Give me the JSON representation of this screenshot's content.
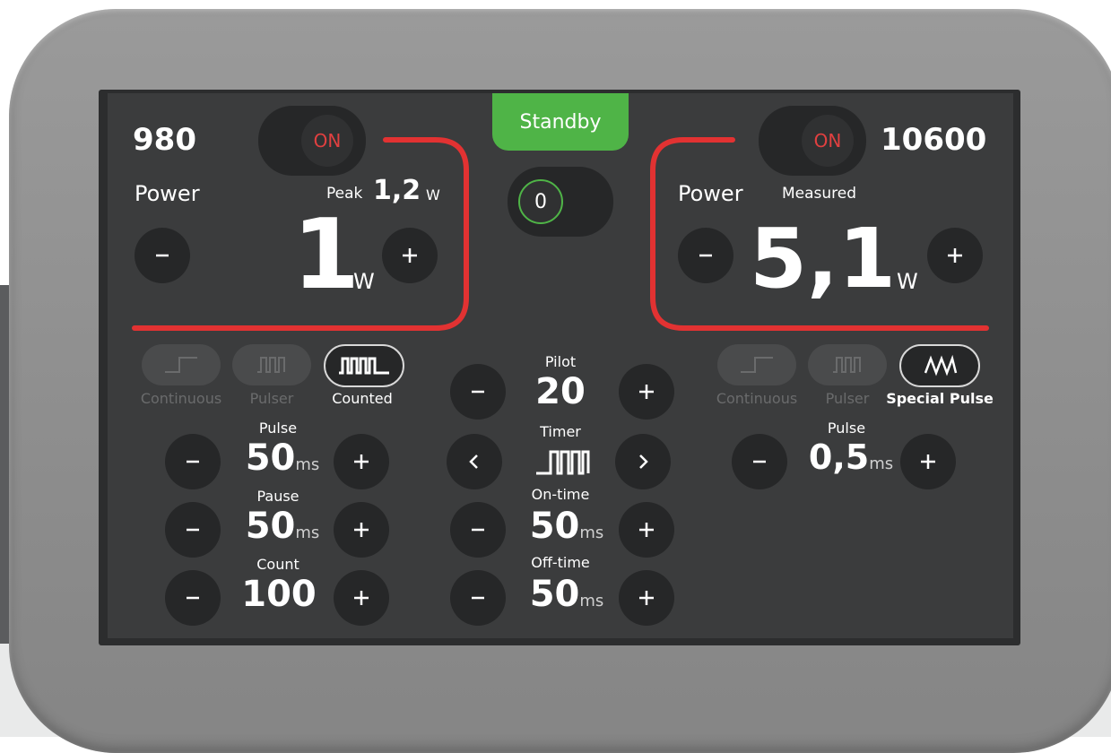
{
  "colors": {
    "accent_red": "#e23232",
    "standby_green": "#4fb447",
    "on_red": "#e04040"
  },
  "status": {
    "label": "Standby",
    "counter": "0"
  },
  "left_laser": {
    "wavelength": "980",
    "toggle_label": "ON",
    "power_label": "Power",
    "peak_label": "Peak",
    "peak_value": "1,2",
    "peak_unit": "W",
    "power_value": "1",
    "power_unit": "W",
    "modes": [
      {
        "label": "Continuous",
        "icon": "continuous-wave-icon",
        "active": false
      },
      {
        "label": "Pulser",
        "icon": "pulser-wave-icon",
        "active": false
      },
      {
        "label": "Counted",
        "icon": "counted-wave-icon",
        "active": true
      }
    ],
    "params": [
      {
        "label": "Pulse",
        "value": "50",
        "unit": "ms"
      },
      {
        "label": "Pause",
        "value": "50",
        "unit": "ms"
      },
      {
        "label": "Count",
        "value": "100",
        "unit": ""
      }
    ]
  },
  "center": {
    "pilot_label": "Pilot",
    "pilot_value": "20",
    "timer_label": "Timer",
    "timer_icon": "pulse-train-icon",
    "on_time_label": "On-time",
    "on_time_value": "50",
    "on_time_unit": "ms",
    "off_time_label": "Off-time",
    "off_time_value": "50",
    "off_time_unit": "ms"
  },
  "right_laser": {
    "wavelength": "10600",
    "toggle_label": "ON",
    "power_label": "Power",
    "measured_label": "Measured",
    "power_value": "5,1",
    "power_unit": "W",
    "modes": [
      {
        "label": "Continuous",
        "icon": "continuous-wave-icon",
        "active": false
      },
      {
        "label": "Pulser",
        "icon": "pulser-wave-icon",
        "active": false
      },
      {
        "label": "Special Pulse",
        "icon": "special-pulse-icon",
        "active": true
      }
    ],
    "params": [
      {
        "label": "Pulse",
        "value": "0,5",
        "unit": "ms"
      }
    ]
  }
}
